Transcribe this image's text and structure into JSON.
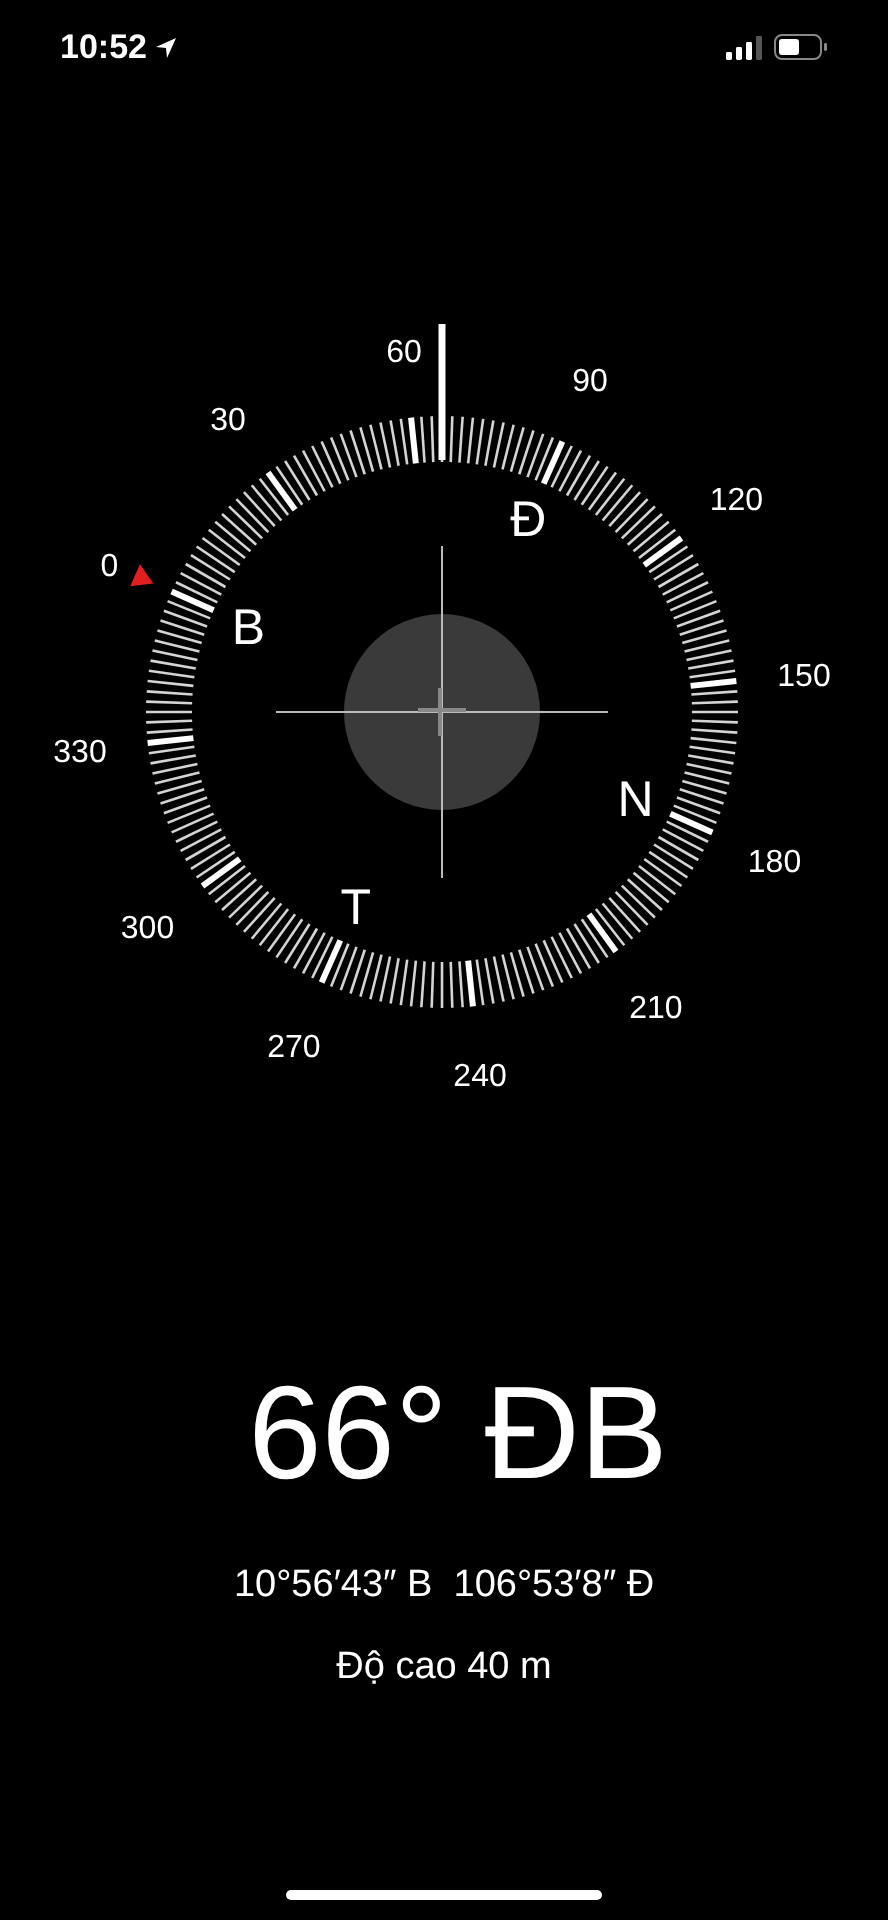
{
  "status_bar": {
    "time": "10:52"
  },
  "dial": {
    "degree_labels": [
      "0",
      "30",
      "60",
      "90",
      "120",
      "150",
      "180",
      "210",
      "240",
      "270",
      "300",
      "330"
    ],
    "cardinals": [
      "B",
      "Đ",
      "N",
      "T"
    ]
  },
  "heading": "66° ĐB",
  "coordinates": "10°56′43″ B  106°53′8″ Đ",
  "altitude": "Độ cao 40 m"
}
